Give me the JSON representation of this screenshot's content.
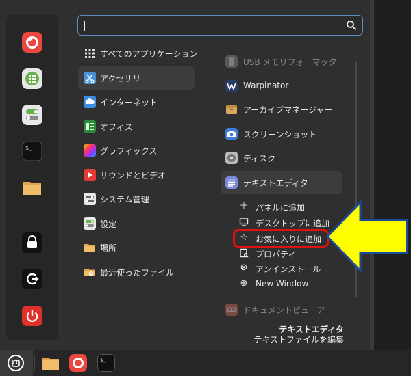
{
  "search": {
    "value": "",
    "placeholder": ""
  },
  "categories": [
    {
      "label": "すべてのアプリケーション",
      "icon": "all-apps-grid-icon"
    },
    {
      "label": "アクセサリ",
      "icon": "accessories-icon"
    },
    {
      "label": "インターネット",
      "icon": "internet-cloud-icon"
    },
    {
      "label": "オフィス",
      "icon": "office-icon"
    },
    {
      "label": "グラフィックス",
      "icon": "graphics-icon"
    },
    {
      "label": "サウンドとビデオ",
      "icon": "sound-video-icon"
    },
    {
      "label": "システム管理",
      "icon": "system-admin-icon"
    },
    {
      "label": "設定",
      "icon": "settings-icon"
    },
    {
      "label": "場所",
      "icon": "places-folder-icon"
    },
    {
      "label": "最近使ったファイル",
      "icon": "recent-files-icon"
    }
  ],
  "apps": [
    {
      "label": "USB メモリフォーマッター",
      "icon": "usb-formatter-icon"
    },
    {
      "label": "Warpinator",
      "icon": "warpinator-icon"
    },
    {
      "label": "アーカイブマネージャー",
      "icon": "archive-manager-icon"
    },
    {
      "label": "スクリーンショット",
      "icon": "screenshot-icon"
    },
    {
      "label": "ディスク",
      "icon": "disks-icon"
    },
    {
      "label": "テキストエディタ",
      "icon": "text-editor-icon"
    },
    {
      "label": "ドキュメントビューアー",
      "icon": "document-viewer-icon"
    }
  ],
  "context_menu": [
    {
      "label": "パネルに追加",
      "icon": "plus-icon"
    },
    {
      "label": "デスクトップに追加",
      "icon": "desktop-icon"
    },
    {
      "label": "お気に入りに追加",
      "icon": "star-icon"
    },
    {
      "label": "プロパティ",
      "icon": "properties-icon"
    },
    {
      "label": "アンインストール",
      "icon": "uninstall-icon"
    },
    {
      "label": "New Window",
      "icon": "new-window-icon"
    }
  ],
  "description": {
    "title": "テキストエディタ",
    "subtitle": "テキストファイルを編集"
  },
  "favorites": [
    "firefox-icon",
    "calculator-icon",
    "toggle-settings-icon",
    "terminal-icon",
    "folder-icon",
    "lock-icon",
    "logout-icon",
    "power-icon"
  ],
  "taskbar": [
    "mint-menu-icon",
    "folder-icon",
    "firefox-icon",
    "terminal-icon"
  ],
  "colors": {
    "accent": "#5d8bbd",
    "highlight": "#e01010",
    "arrow": "#ffff00"
  }
}
